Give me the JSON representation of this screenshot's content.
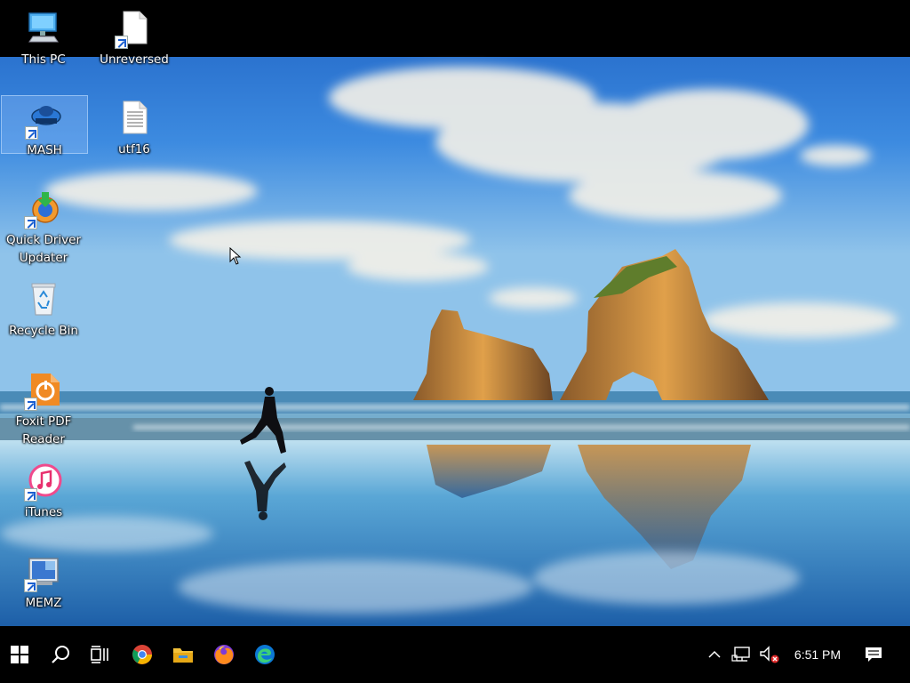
{
  "desktop": {
    "icons": [
      {
        "label": "This PC"
      },
      {
        "label": "Unreversed"
      },
      {
        "label": "MASH"
      },
      {
        "label": "utf16"
      },
      {
        "label": "Quick Driver\nUpdater"
      },
      {
        "label": "Recycle Bin"
      },
      {
        "label": "Foxit PDF\nReader"
      },
      {
        "label": "iTunes"
      },
      {
        "label": "MEMZ"
      }
    ]
  },
  "taskbar": {
    "buttons": [
      {
        "icon": "windows-start-icon"
      },
      {
        "icon": "search-icon"
      },
      {
        "icon": "task-view-icon"
      },
      {
        "icon": "chrome-icon"
      },
      {
        "icon": "file-explorer-icon"
      },
      {
        "icon": "firefox-icon"
      },
      {
        "icon": "edge-icon"
      }
    ],
    "tray": {
      "icons": [
        "chevron-up-icon",
        "network-icon",
        "volume-muted-icon"
      ],
      "clock": "6:51 PM",
      "notification_icon": "action-center-icon"
    }
  },
  "colors": {
    "sky_top": "#2a6fd0",
    "sea": "#3f8fc8",
    "taskbar": "#000000",
    "selection": "#aacdff"
  }
}
